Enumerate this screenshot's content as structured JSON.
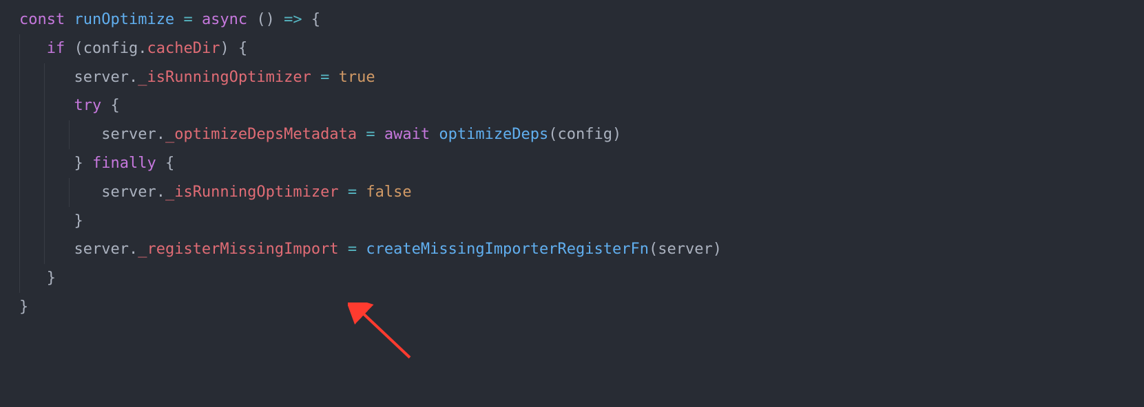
{
  "code": {
    "lines": [
      {
        "indent": 0,
        "tokens": [
          {
            "t": "const ",
            "c": "kw"
          },
          {
            "t": "runOptimize",
            "c": "fn"
          },
          {
            "t": " ",
            "c": "pn"
          },
          {
            "t": "=",
            "c": "op"
          },
          {
            "t": " ",
            "c": "pn"
          },
          {
            "t": "async",
            "c": "kw"
          },
          {
            "t": " () ",
            "c": "pn"
          },
          {
            "t": "=>",
            "c": "op"
          },
          {
            "t": " {",
            "c": "pn"
          }
        ]
      },
      {
        "indent": 1,
        "tokens": [
          {
            "t": "if",
            "c": "kw"
          },
          {
            "t": " (",
            "c": "pn"
          },
          {
            "t": "config",
            "c": "gry"
          },
          {
            "t": ".",
            "c": "pn"
          },
          {
            "t": "cacheDir",
            "c": "prop"
          },
          {
            "t": ") {",
            "c": "pn"
          }
        ]
      },
      {
        "indent": 2,
        "tokens": [
          {
            "t": "server",
            "c": "gry"
          },
          {
            "t": ".",
            "c": "pn"
          },
          {
            "t": "_isRunningOptimizer",
            "c": "prop"
          },
          {
            "t": " ",
            "c": "pn"
          },
          {
            "t": "=",
            "c": "op"
          },
          {
            "t": " ",
            "c": "pn"
          },
          {
            "t": "true",
            "c": "str"
          }
        ]
      },
      {
        "indent": 2,
        "tokens": [
          {
            "t": "try",
            "c": "kw"
          },
          {
            "t": " {",
            "c": "pn"
          }
        ]
      },
      {
        "indent": 3,
        "tokens": [
          {
            "t": "server",
            "c": "gry"
          },
          {
            "t": ".",
            "c": "pn"
          },
          {
            "t": "_optimizeDepsMetadata",
            "c": "prop"
          },
          {
            "t": " ",
            "c": "pn"
          },
          {
            "t": "=",
            "c": "op"
          },
          {
            "t": " ",
            "c": "pn"
          },
          {
            "t": "await",
            "c": "kw"
          },
          {
            "t": " ",
            "c": "pn"
          },
          {
            "t": "optimizeDeps",
            "c": "fn"
          },
          {
            "t": "(",
            "c": "pn"
          },
          {
            "t": "config",
            "c": "gry"
          },
          {
            "t": ")",
            "c": "pn"
          }
        ]
      },
      {
        "indent": 2,
        "tokens": [
          {
            "t": "} ",
            "c": "pn"
          },
          {
            "t": "finally",
            "c": "kw"
          },
          {
            "t": " {",
            "c": "pn"
          }
        ]
      },
      {
        "indent": 3,
        "tokens": [
          {
            "t": "server",
            "c": "gry"
          },
          {
            "t": ".",
            "c": "pn"
          },
          {
            "t": "_isRunningOptimizer",
            "c": "prop"
          },
          {
            "t": " ",
            "c": "pn"
          },
          {
            "t": "=",
            "c": "op"
          },
          {
            "t": " ",
            "c": "pn"
          },
          {
            "t": "false",
            "c": "str"
          }
        ]
      },
      {
        "indent": 2,
        "tokens": [
          {
            "t": "}",
            "c": "pn"
          }
        ]
      },
      {
        "indent": 2,
        "tokens": [
          {
            "t": "server",
            "c": "gry"
          },
          {
            "t": ".",
            "c": "pn"
          },
          {
            "t": "_registerMissingImport",
            "c": "prop"
          },
          {
            "t": " ",
            "c": "pn"
          },
          {
            "t": "=",
            "c": "op"
          },
          {
            "t": " ",
            "c": "pn"
          },
          {
            "t": "createMissingImporterRegisterFn",
            "c": "fn"
          },
          {
            "t": "(",
            "c": "pn"
          },
          {
            "t": "server",
            "c": "gry"
          },
          {
            "t": ")",
            "c": "pn"
          }
        ]
      },
      {
        "indent": 1,
        "tokens": [
          {
            "t": "}",
            "c": "pn"
          }
        ]
      },
      {
        "indent": 0,
        "tokens": [
          {
            "t": "}",
            "c": "pn"
          }
        ]
      }
    ]
  },
  "annotation": {
    "type": "arrow",
    "color": "#ff3b2f",
    "points_to": "_registerMissingImport"
  }
}
